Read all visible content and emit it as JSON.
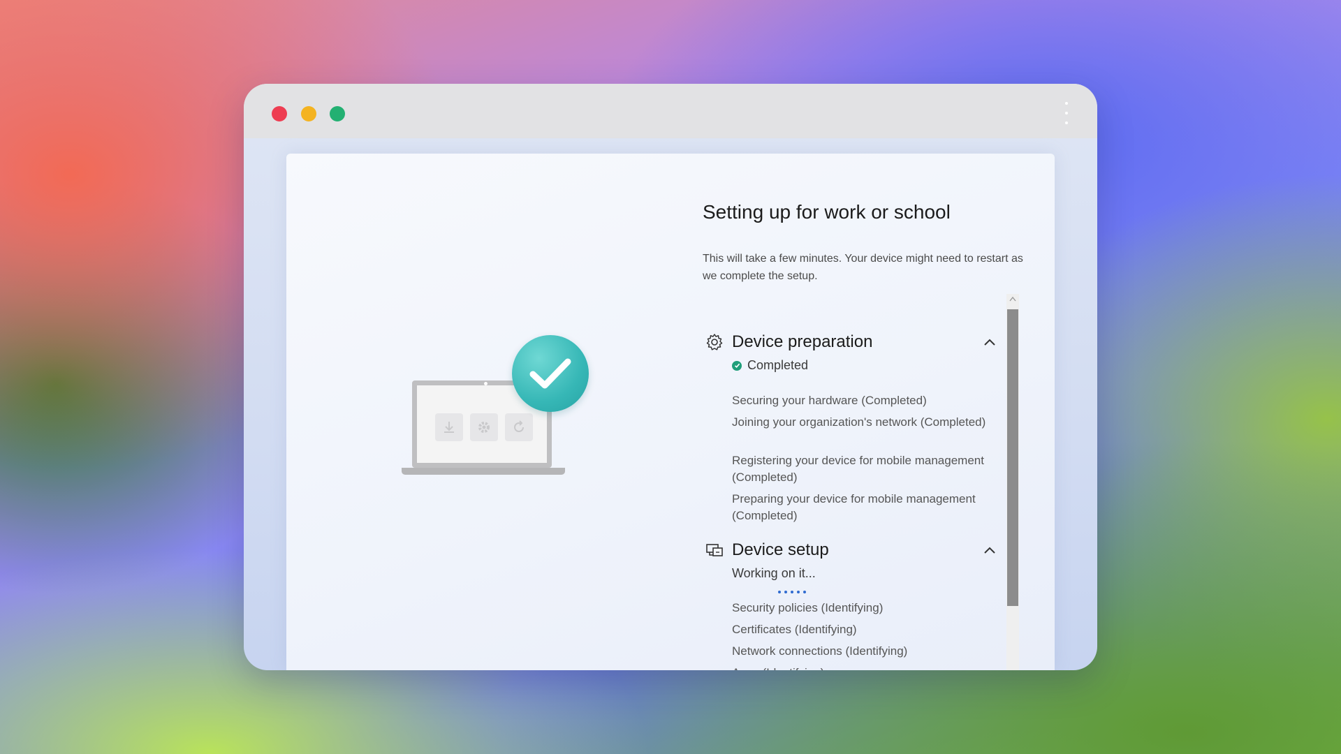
{
  "window": {
    "controls": [
      "close",
      "minimize",
      "maximize"
    ],
    "menu_icon": "more-vertical-icon"
  },
  "page": {
    "title": "Setting up for work or school",
    "subtitle": "This will take a few minutes. Your device might need to restart as we complete the setup."
  },
  "sections": [
    {
      "title": "Device preparation",
      "icon": "gear-icon",
      "status": "Completed",
      "items": [
        "Securing your hardware (Completed)",
        "Joining your organization's network (Completed)",
        "Registering your device for mobile management (Completed)",
        "Preparing your device for mobile management (Completed)"
      ]
    },
    {
      "title": "Device setup",
      "icon": "device-setup-icon",
      "status": "Working on it...",
      "items": [
        "Security policies (Identifying)",
        "Certificates (Identifying)",
        "Network connections (Identifying)",
        "Apps (Identifying)"
      ]
    }
  ],
  "colors": {
    "close": "#ee3d52",
    "minimize": "#f4b321",
    "maximize": "#23b072",
    "completed": "#1f9e7a",
    "progress": "#2f6bd0",
    "check_badge": "#36b7b6"
  }
}
